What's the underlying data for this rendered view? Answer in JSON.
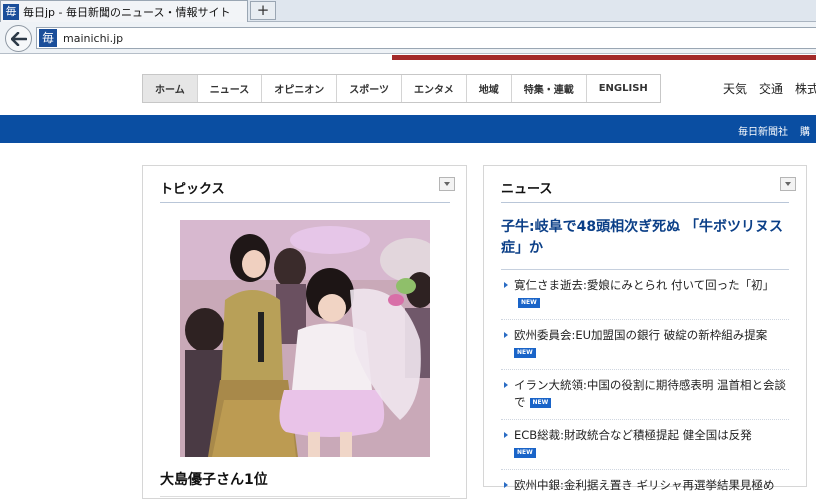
{
  "browser": {
    "tab_title": "毎日jp - 毎日新聞のニュース・情報サイト",
    "favicon_text": "毎",
    "new_tab_label": "+",
    "url": "mainichi.jp"
  },
  "site_nav": {
    "items": [
      "ホーム",
      "ニュース",
      "オピニオン",
      "スポーツ",
      "エンタメ",
      "地域",
      "特集・連載",
      "ENGLISH"
    ],
    "active": "ホーム"
  },
  "utility_links": [
    "天気",
    "交通",
    "株式"
  ],
  "blue_bar_links": [
    "毎日新聞社",
    "購"
  ],
  "topics": {
    "heading": "トピックス",
    "caption": "大島優子さん1位"
  },
  "news": {
    "heading": "ニュース",
    "headline": "子牛:岐阜で48頭相次ぎ死ぬ 「牛ボツリヌス症」か",
    "new_badge": "NEW",
    "items": [
      {
        "text": "寛仁さま逝去:愛娘にみとられ 付いて回った「初」",
        "is_new": true
      },
      {
        "text": "欧州委員会:EU加盟国の銀行 破綻の新枠組み提案",
        "is_new": true
      },
      {
        "text": "イラン大統領:中国の役割に期待感表明 温首相と会談で",
        "is_new": true
      },
      {
        "text": "ECB総裁:財政統合など積極提起 健全国は反発",
        "is_new": true
      },
      {
        "text": "欧州中銀:金利据え置き ギリシャ再選挙結果見極め",
        "is_new": false
      }
    ]
  },
  "colors": {
    "brand_blue": "#0a4ea2",
    "headline_blue": "#0b3f87",
    "badge_blue": "#1a64c8"
  }
}
